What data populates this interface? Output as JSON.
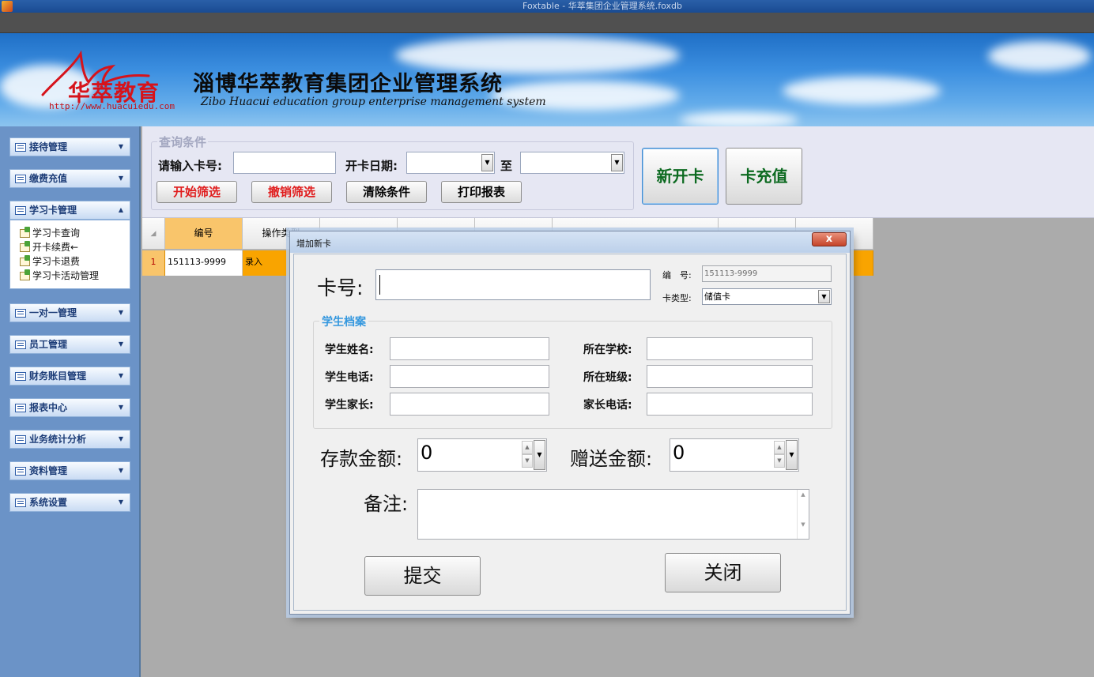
{
  "window": {
    "title": "Foxtable - 华萃集团企业管理系统.foxdb"
  },
  "banner": {
    "logo_text": "华萃教育",
    "logo_url": "http://www.huacuiedu.com",
    "title": "淄博华萃教育集团企业管理系统",
    "subtitle": "Zibo Huacui education group enterprise management system"
  },
  "sidebar": {
    "items": [
      {
        "label": "接待管理"
      },
      {
        "label": "缴费充值"
      },
      {
        "label": "学习卡管理"
      },
      {
        "label": "一对一管理"
      },
      {
        "label": "员工管理"
      },
      {
        "label": "财务账目管理"
      },
      {
        "label": "报表中心"
      },
      {
        "label": "业务统计分析"
      },
      {
        "label": "资料管理"
      },
      {
        "label": "系统设置"
      }
    ],
    "subitems": [
      {
        "label": "学习卡查询"
      },
      {
        "label": "开卡续费←"
      },
      {
        "label": "学习卡退费"
      },
      {
        "label": "学习卡活动管理"
      }
    ]
  },
  "query": {
    "legend": "查询条件",
    "card_label": "请输入卡号:",
    "card_value": "",
    "date_label": "开卡日期:",
    "date_from": "",
    "to_label": "至",
    "date_to": "",
    "buttons": {
      "start_filter": "开始筛选",
      "cancel_filter": "撤销筛选",
      "clear": "清除条件",
      "print": "打印报表"
    }
  },
  "actions": {
    "new_card": "新开卡",
    "recharge": "卡充值"
  },
  "grid": {
    "columns": [
      "编号",
      "操作类型"
    ],
    "rows": [
      {
        "index": "1",
        "cells": [
          "151113-9999",
          "录入"
        ]
      }
    ]
  },
  "dialog": {
    "title": "增加新卡",
    "close_symbol": "x",
    "card_no_label": "卡号:",
    "card_no_value": "",
    "serial_label": "编　号:",
    "serial_value": "151113-9999",
    "card_type_label": "卡类型:",
    "card_type_value": "储值卡",
    "student_legend": "学生档案",
    "fields": {
      "student_name": {
        "label": "学生姓名:",
        "value": ""
      },
      "student_phone": {
        "label": "学生电话:",
        "value": ""
      },
      "student_parent": {
        "label": "学生家长:",
        "value": ""
      },
      "school": {
        "label": "所在学校:",
        "value": ""
      },
      "class": {
        "label": "所在班级:",
        "value": ""
      },
      "parent_phone": {
        "label": "家长电话:",
        "value": ""
      }
    },
    "deposit_label": "存款金额:",
    "deposit_value": "0",
    "bonus_label": "赠送金额:",
    "bonus_value": "0",
    "remark_label": "备注:",
    "remark_value": "",
    "submit": "提交",
    "close": "关闭"
  },
  "colors": {
    "sidebar": "#6b93c7",
    "row_highlight": "#f9a400",
    "action_text": "#0c6a20",
    "filter_text": "#e01d1d",
    "legend_blue": "#3397de"
  }
}
